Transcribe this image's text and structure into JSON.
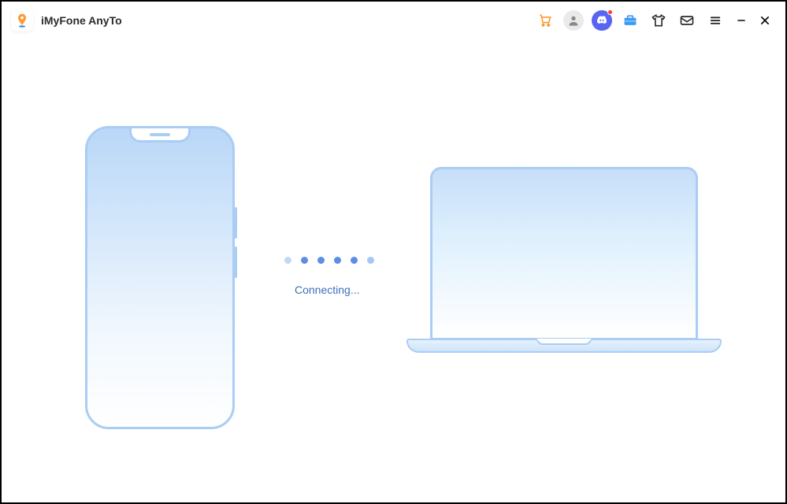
{
  "app": {
    "title": "iMyFone AnyTo"
  },
  "status": {
    "text": "Connecting..."
  },
  "titlebar_icons": {
    "cart": "cart-icon",
    "user": "user-icon",
    "discord": "discord-icon",
    "toolbox": "toolbox-icon",
    "tshirt": "tshirt-icon",
    "mail": "mail-icon",
    "menu": "menu-icon",
    "minimize": "minimize",
    "close": "close"
  }
}
